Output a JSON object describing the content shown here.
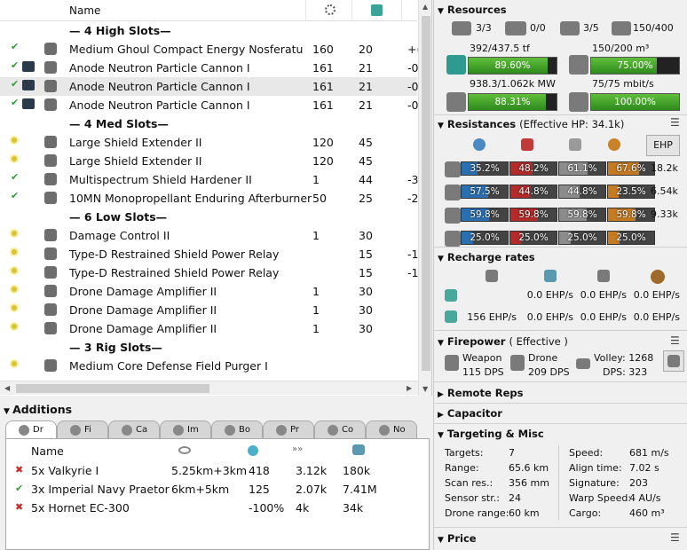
{
  "grid": {
    "headers": {
      "name": "Name",
      "col1_icon": "cpu-icon",
      "col2_icon": "powergrid-icon"
    },
    "racks": [
      {
        "label": "— 4 High Slots—"
      },
      {
        "label": "— 4 Med Slots—"
      },
      {
        "label": "— 6 Low Slots—"
      },
      {
        "label": "— 3 Rig Slots—"
      }
    ],
    "modules": [
      {
        "state": "ok",
        "charge": false,
        "name": "Medium Ghoul Compact Energy Nosferatu",
        "cpu": "160",
        "pg": "20",
        "extra": "+("
      },
      {
        "state": "ok",
        "charge": true,
        "name": "Anode Neutron Particle Cannon I",
        "cpu": "161",
        "pg": "21",
        "extra": "-0"
      },
      {
        "state": "ok",
        "charge": true,
        "name": "Anode Neutron Particle Cannon I",
        "cpu": "161",
        "pg": "21",
        "extra": "-0"
      },
      {
        "state": "ok",
        "charge": true,
        "name": "Anode Neutron Particle Cannon I",
        "cpu": "161",
        "pg": "21",
        "extra": "-0"
      },
      {
        "state": "off",
        "charge": false,
        "name": "Large Shield Extender II",
        "cpu": "120",
        "pg": "45",
        "extra": ""
      },
      {
        "state": "off",
        "charge": false,
        "name": "Large Shield Extender II",
        "cpu": "120",
        "pg": "45",
        "extra": ""
      },
      {
        "state": "ok",
        "charge": false,
        "name": "Multispectrum Shield Hardener II",
        "cpu": "1",
        "pg": "44",
        "extra": "-3"
      },
      {
        "state": "ok",
        "charge": false,
        "name": "10MN Monopropellant Enduring Afterburner",
        "cpu": "50",
        "pg": "25",
        "extra": "-2"
      },
      {
        "state": "off",
        "charge": false,
        "name": "Damage Control II",
        "cpu": "1",
        "pg": "30",
        "extra": ""
      },
      {
        "state": "off",
        "charge": false,
        "name": "Type-D Restrained Shield Power Relay",
        "cpu": "",
        "pg": "15",
        "extra": "-1"
      },
      {
        "state": "off",
        "charge": false,
        "name": "Type-D Restrained Shield Power Relay",
        "cpu": "",
        "pg": "15",
        "extra": "-1"
      },
      {
        "state": "off",
        "charge": false,
        "name": "Drone Damage Amplifier II",
        "cpu": "1",
        "pg": "30",
        "extra": ""
      },
      {
        "state": "off",
        "charge": false,
        "name": "Drone Damage Amplifier II",
        "cpu": "1",
        "pg": "30",
        "extra": ""
      },
      {
        "state": "off",
        "charge": false,
        "name": "Drone Damage Amplifier II",
        "cpu": "1",
        "pg": "30",
        "extra": ""
      },
      {
        "state": "off",
        "charge": false,
        "name": "Medium Core Defense Field Purger I",
        "cpu": "",
        "pg": "",
        "extra": ""
      }
    ]
  },
  "additions": {
    "title": "Additions",
    "tabs": [
      "Dr",
      "Fi",
      "Ca",
      "Im",
      "Bo",
      "Pr",
      "Co",
      "No"
    ],
    "header_name": "Name",
    "rows": [
      {
        "state": "x",
        "name": "5x Valkyrie I",
        "range": "5.25km+3km",
        "speed": "418",
        "c1": "3.12k",
        "c2": "180k"
      },
      {
        "state": "ok",
        "name": "3x Imperial Navy Praetor",
        "range": "6km+5km",
        "speed": "125",
        "c1": "2.07k",
        "c2": "7.41M"
      },
      {
        "state": "x",
        "name": "5x Hornet EC-300",
        "range": "",
        "speed": "-100%",
        "c1": "4k",
        "c2": "34k"
      }
    ]
  },
  "resources": {
    "title": "Resources",
    "counts": [
      "3/3",
      "0/0",
      "3/5",
      "150/400"
    ],
    "cpu_text": "392/437.5 tf",
    "cpu_pct_label": "89.60%",
    "cpu_pct": 89.6,
    "bay_text": "150/200 m³",
    "bay_pct_label": "75.00%",
    "bay_pct": 75,
    "pg_text": "938.3/1.062k MW",
    "pg_pct_label": "88.31%",
    "pg_pct": 88.31,
    "bw_text": "75/75 mbit/s",
    "bw_pct_label": "100.00%",
    "bw_pct": 100
  },
  "resistances": {
    "title": "Resistances",
    "subtitle": "(Effective HP: 34.1k)",
    "ehp_button": "EHP",
    "rows": [
      {
        "cells": [
          "35.2%",
          "48.2%",
          "61.1%",
          "67.6%"
        ],
        "pcts": [
          35.2,
          48.2,
          61.1,
          67.6
        ],
        "ehp": "18.2k"
      },
      {
        "cells": [
          "57.5%",
          "44.8%",
          "44.8%",
          "23.5%"
        ],
        "pcts": [
          57.5,
          44.8,
          44.8,
          23.5
        ],
        "ehp": "6.54k"
      },
      {
        "cells": [
          "59.8%",
          "59.8%",
          "59.8%",
          "59.8%"
        ],
        "pcts": [
          59.8,
          59.8,
          59.8,
          59.8
        ],
        "ehp": "9.33k"
      },
      {
        "cells": [
          "25.0%",
          "25.0%",
          "25.0%",
          "25.0%"
        ],
        "pcts": [
          25,
          25,
          25,
          25
        ],
        "ehp": ""
      }
    ],
    "colors": [
      "#2b6fb0",
      "#b32a2a",
      "#8c8c8c",
      "#c67a22"
    ]
  },
  "recharge": {
    "title": "Recharge rates",
    "row1": [
      "",
      "0.0 EHP/s",
      "0.0 EHP/s",
      "0.0 EHP/s"
    ],
    "row2": [
      "156 EHP/s",
      "0.0 EHP/s",
      "0.0 EHP/s",
      "0.0 EHP/s"
    ]
  },
  "firepower": {
    "title": "Firepower",
    "subtitle": "( Effective )",
    "weapon_label": "Weapon",
    "weapon_dps": "115 DPS",
    "drone_label": "Drone",
    "drone_dps": "209 DPS",
    "volley": "Volley: 1268",
    "dps": "DPS: 323"
  },
  "collapsed": {
    "remote_reps": "Remote Reps",
    "capacitor": "Capacitor",
    "price": "Price"
  },
  "targeting": {
    "title": "Targeting & Misc",
    "left": [
      {
        "k": "Targets:",
        "v": "7"
      },
      {
        "k": "Range:",
        "v": "65.6 km"
      },
      {
        "k": "Scan res.:",
        "v": "356 mm"
      },
      {
        "k": "Sensor str.:",
        "v": "24"
      },
      {
        "k": "Drone range:",
        "v": "60 km"
      }
    ],
    "right": [
      {
        "k": "Speed:",
        "v": "681 m/s"
      },
      {
        "k": "Align time:",
        "v": "7.02 s"
      },
      {
        "k": "Signature:",
        "v": "203"
      },
      {
        "k": "Warp Speed:",
        "v": "4 AU/s"
      },
      {
        "k": "Cargo:",
        "v": "460 m³"
      }
    ]
  }
}
